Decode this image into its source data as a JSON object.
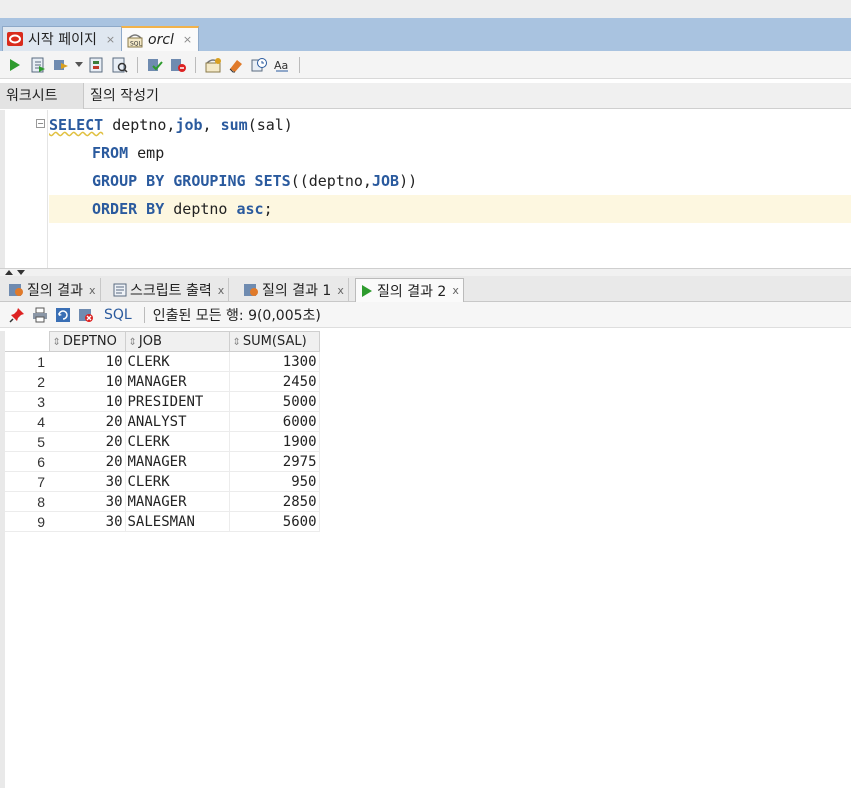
{
  "doc_tabs": [
    {
      "label": "시작 페이지",
      "close": "×"
    },
    {
      "label": "orcl",
      "close": "×"
    }
  ],
  "sub_tabs": [
    "워크시트",
    "질의 작성기"
  ],
  "sql": {
    "line1": {
      "kw1": "SELECT",
      "t1": " deptno,",
      "kw2": "job",
      "t2": ", ",
      "kw3": "sum",
      "t3": "(sal)"
    },
    "line2": {
      "kw1": "FROM",
      "t1": " emp"
    },
    "line3": {
      "kw1": "GROUP BY GROUPING SETS",
      "t1": "((deptno,",
      "kw2": "JOB",
      "t2": "))"
    },
    "line4": {
      "kw1": "ORDER BY",
      "t1": " deptno ",
      "kw2": "asc",
      "t2": ";"
    }
  },
  "result_tabs": [
    {
      "label": "질의 결과",
      "close": "x"
    },
    {
      "label": "스크립트 출력",
      "close": "x"
    },
    {
      "label": "질의 결과 1",
      "close": "x"
    },
    {
      "label": "질의 결과 2",
      "close": "x"
    }
  ],
  "result_toolbar": {
    "sql_label": "SQL",
    "status": "인출된 모든 행: 9(0,005초)"
  },
  "grid": {
    "columns": [
      "DEPTNO",
      "JOB",
      "SUM(SAL)"
    ],
    "rows": [
      [
        "1",
        "10",
        "CLERK",
        "1300"
      ],
      [
        "2",
        "10",
        "MANAGER",
        "2450"
      ],
      [
        "3",
        "10",
        "PRESIDENT",
        "5000"
      ],
      [
        "4",
        "20",
        "ANALYST",
        "6000"
      ],
      [
        "5",
        "20",
        "CLERK",
        "1900"
      ],
      [
        "6",
        "20",
        "MANAGER",
        "2975"
      ],
      [
        "7",
        "30",
        "CLERK",
        "950"
      ],
      [
        "8",
        "30",
        "MANAGER",
        "2850"
      ],
      [
        "9",
        "30",
        "SALESMAN",
        "5600"
      ]
    ]
  },
  "colors": {
    "keyword": "#2a5a9e",
    "tab_bar": "#a9c3e0",
    "active_tab_accent": "#f2b24a",
    "current_line": "#fdf7e0"
  }
}
